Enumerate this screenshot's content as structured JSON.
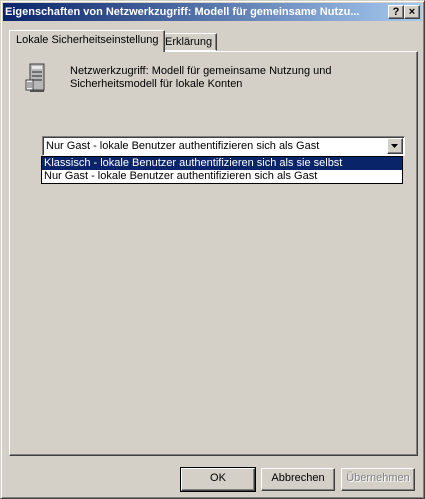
{
  "window": {
    "title": "Eigenschaften von Netzwerkzugriff: Modell für gemeinsame Nutzu...",
    "help_label": "?",
    "close_label": "×"
  },
  "tabs": [
    {
      "label": "Lokale Sicherheitseinstellung",
      "active": true
    },
    {
      "label": "Erklärung",
      "active": false
    }
  ],
  "policy": {
    "icon": "server-policy-icon",
    "line1": "Netzwerkzugriff: Modell für gemeinsame Nutzung und",
    "line2": "Sicherheitsmodell für lokale Konten"
  },
  "combo": {
    "selected": "Nur Gast - lokale Benutzer authentifizieren sich als Gast"
  },
  "dropdown": {
    "options": [
      "Klassisch - lokale Benutzer authentifizieren sich als sie selbst",
      "Nur Gast - lokale Benutzer authentifizieren sich als Gast"
    ],
    "highlighted_index": 0
  },
  "buttons": {
    "ok": "OK",
    "cancel": "Abbrechen",
    "apply": "Übernehmen"
  },
  "colors": {
    "title_bar": "#0a246a",
    "highlight": "#0a246a",
    "face": "#d4d0c8"
  }
}
